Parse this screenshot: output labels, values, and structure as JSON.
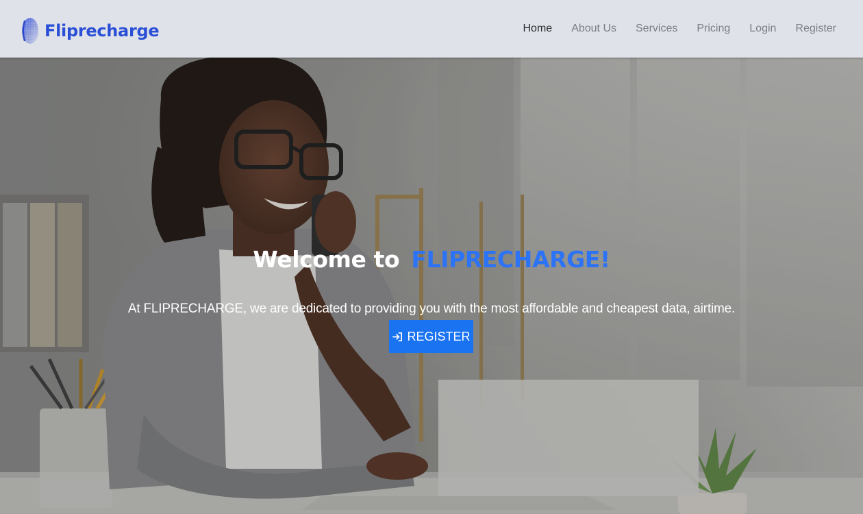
{
  "brand": {
    "name": "Fliprecharge",
    "logo_icon": "globe-sphere-icon",
    "color": "#2a4fd6"
  },
  "nav": {
    "items": [
      {
        "label": "Home",
        "active": true
      },
      {
        "label": "About Us",
        "active": false
      },
      {
        "label": "Services",
        "active": false
      },
      {
        "label": "Pricing",
        "active": false
      },
      {
        "label": "Login",
        "active": false
      },
      {
        "label": "Register",
        "active": false
      }
    ]
  },
  "hero": {
    "title_prefix": "Welcome to",
    "title_accent": "FLIPRECHARGE!",
    "accent_color": "#2d73f5",
    "subtitle": "At FLIPRECHARGE, we are dedicated to providing you with the most affordable and cheapest data, airtime.",
    "cta_label": "REGISTER",
    "cta_icon": "login-arrow-icon",
    "cta_color": "#1a73f0",
    "background": "woman-on-phone-at-laptop-photo"
  }
}
